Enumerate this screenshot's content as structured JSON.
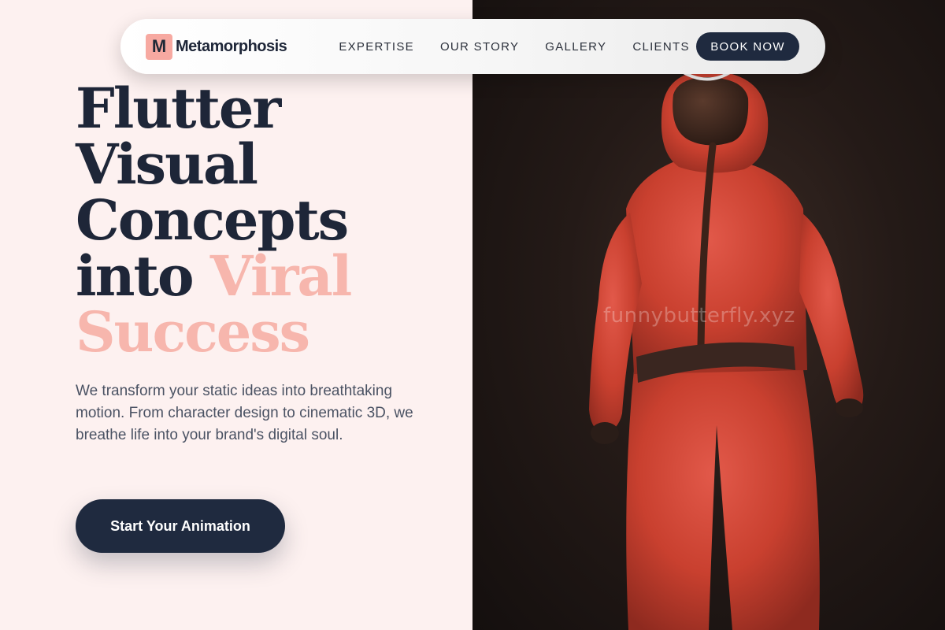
{
  "brand": {
    "mark": "M",
    "name": "Metamorphosis"
  },
  "nav": {
    "links": [
      "EXPERTISE",
      "OUR STORY",
      "GALLERY",
      "CLIENTS"
    ],
    "cta": "BOOK NOW"
  },
  "hero": {
    "headline_lines": [
      "Flutter",
      "Visual",
      "Concepts",
      "into "
    ],
    "headline_accent_1": "Viral",
    "headline_accent_2": "Success",
    "tagline": "We transform your static ideas into breathtaking motion. From character design to cinematic 3D, we breathe life into your brand's digital soul.",
    "cta": "Start Your Animation"
  },
  "image": {
    "watermark": "funnybutterfly.xyz",
    "subject": "red-hooded-jumpsuit-figure"
  },
  "colors": {
    "navy": "#1f2a3f",
    "pink": "#f7b6ad",
    "background": "#fdf1f0",
    "suit_red": "#d4493a"
  }
}
